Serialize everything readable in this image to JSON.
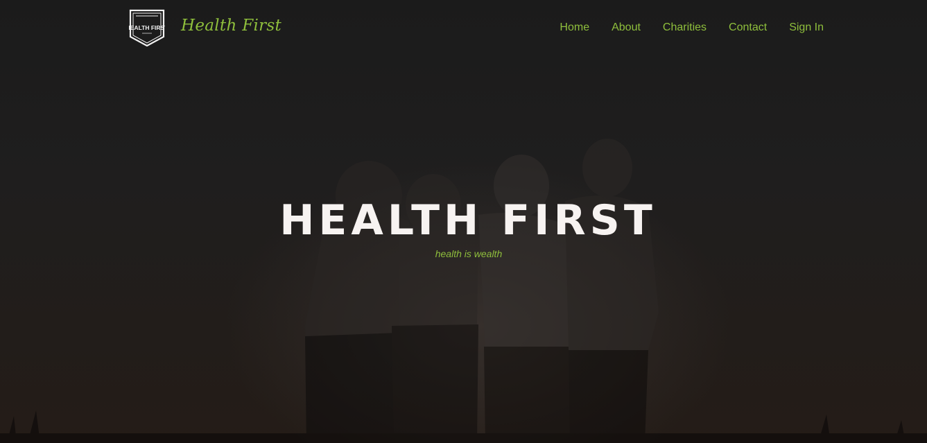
{
  "brand": {
    "logo_text": "HEALTH FIRST",
    "name": "Health First"
  },
  "nav": {
    "items": [
      {
        "label": "Home"
      },
      {
        "label": "About"
      },
      {
        "label": "Charities"
      },
      {
        "label": "Contact"
      },
      {
        "label": "Sign In"
      }
    ]
  },
  "hero": {
    "title": "HEALTH FIRST",
    "subtitle": "health is wealth",
    "background_image": "four-people-embracing-silhouette"
  },
  "colors": {
    "accent": "#8fbf3c",
    "title": "#f7f3f1",
    "background": "#1b1b1b"
  }
}
